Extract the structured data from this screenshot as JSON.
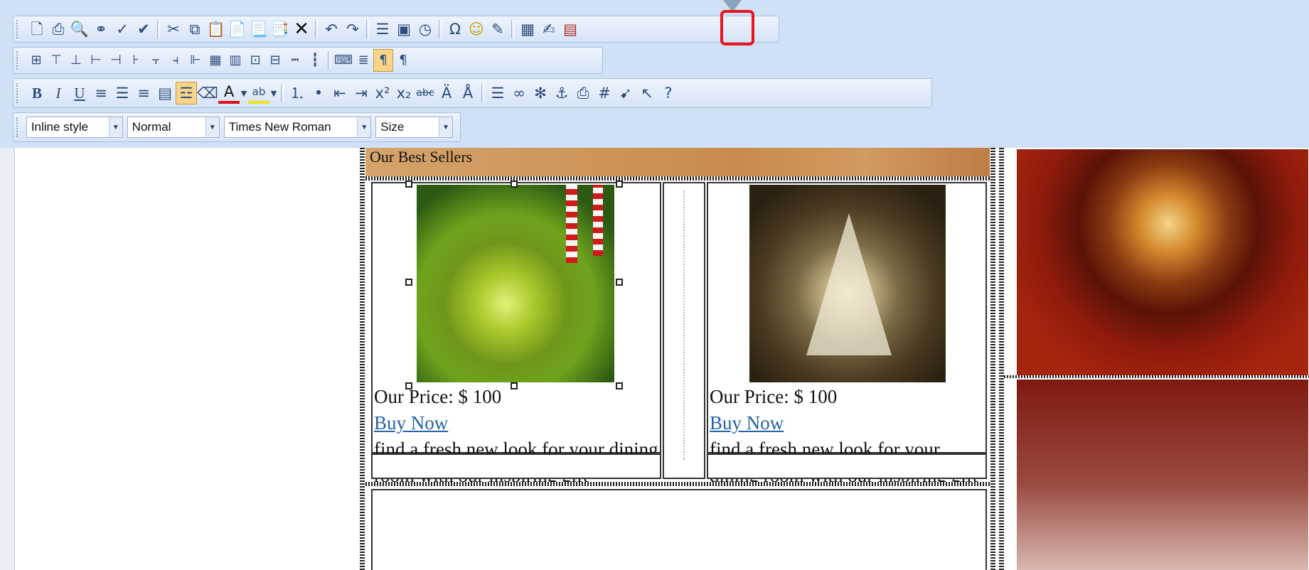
{
  "toolbar": {
    "row1": [
      "new-document",
      "print",
      "print-preview",
      "find",
      "spell-check",
      "spell-check-as-you-type",
      "cut",
      "copy",
      "paste",
      "paste-from-word",
      "paste-plain-text",
      "paste-as-html",
      "delete",
      "undo",
      "redo",
      "insert-paragraph",
      "form",
      "clock",
      "insert-symbol",
      "smiley",
      "insert-snippet",
      "image-map",
      "edit-image",
      "pdf"
    ],
    "row2": [
      "insert-table",
      "insert-row-above",
      "insert-row-below",
      "insert-column-right",
      "delete-row",
      "delete-column",
      "merge-cells",
      "split-cell",
      "table-properties",
      "cell-properties",
      "show-borders",
      "horizontal-rule",
      "page-break",
      "toggle-dir",
      "ltr",
      "rtl",
      "paragraph-ltr",
      "paragraph-rtl"
    ],
    "row3": [
      "bold",
      "italic",
      "underline",
      "align-left",
      "align-center",
      "align-right",
      "justify",
      "highlight",
      "eraser",
      "font-color",
      "background-color",
      "ordered-list",
      "unordered-list",
      "outdent",
      "indent",
      "superscript",
      "subscript",
      "strikethrough",
      "increase-size",
      "decrease-size",
      "insert-line",
      "link",
      "unlink",
      "anchor",
      "image",
      "grid",
      "absolute-position",
      "pointer",
      "help"
    ],
    "format_dropdowns": [
      {
        "label": "Inline style"
      },
      {
        "label": "Normal"
      },
      {
        "label": "Times New Roman"
      },
      {
        "label": "Size"
      }
    ]
  },
  "content": {
    "section_title": "Our Best Sellers",
    "products": [
      {
        "price_label": "Our Price: $ 100",
        "buy_label": "Buy Now",
        "description": "find a fresh new look for your dining room with our inspiring gift collection.",
        "image": "green-ornament"
      },
      {
        "price_label": "Our Price: $ 100",
        "buy_label": "Buy Now",
        "description": "find a fresh new look for your dining room with our inspiring gift collection.",
        "image": "glass-tree"
      }
    ]
  },
  "colors": {
    "toolbar_bg": "#cfe0f7",
    "highlight": "#e8161c",
    "link": "#2263a8"
  }
}
